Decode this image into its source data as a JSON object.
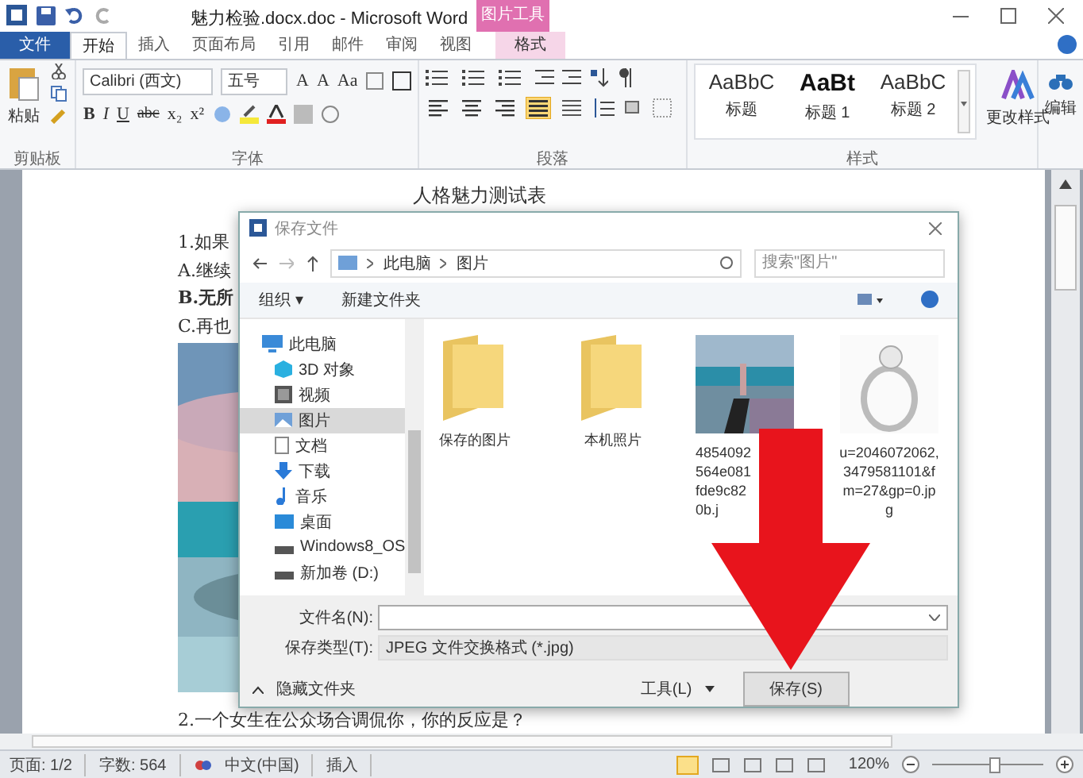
{
  "window": {
    "title": "魅力检验.docx.doc - Microsoft Word",
    "context_tab": "图片工具"
  },
  "tabs": [
    {
      "label": "文件",
      "kind": "file",
      "selected": false
    },
    {
      "label": "开始",
      "kind": "normal",
      "selected": true
    },
    {
      "label": "插入",
      "kind": "normal",
      "selected": false
    },
    {
      "label": "页面布局",
      "kind": "normal",
      "selected": false
    },
    {
      "label": "引用",
      "kind": "normal",
      "selected": false
    },
    {
      "label": "邮件",
      "kind": "normal",
      "selected": false
    },
    {
      "label": "审阅",
      "kind": "normal",
      "selected": false
    },
    {
      "label": "视图",
      "kind": "normal",
      "selected": false
    },
    {
      "label": "格式",
      "kind": "context",
      "selected": false
    }
  ],
  "ribbon": {
    "clipboard": {
      "paste": "粘贴",
      "label": "剪贴板"
    },
    "font": {
      "name": "Calibri (西文)",
      "size": "五号",
      "row1": [
        "A",
        "A",
        "Aa"
      ],
      "row2": [
        "B",
        "I",
        "U",
        "abc",
        "x₂",
        "x²"
      ],
      "label": "字体"
    },
    "paragraph": {
      "alignments": [
        {
          "kind": "left",
          "selected": false
        },
        {
          "kind": "center",
          "selected": false
        },
        {
          "kind": "right",
          "selected": false
        },
        {
          "kind": "justify",
          "selected": true
        },
        {
          "kind": "distributed",
          "selected": false
        }
      ],
      "label": "段落"
    },
    "styles": {
      "items": [
        {
          "preview": "AaBbC",
          "name": "标题",
          "kind": "normal"
        },
        {
          "preview": "AaBt",
          "name": "标题 1",
          "kind": "bold"
        },
        {
          "preview": "AaBbC",
          "name": "标题 2",
          "kind": "normal"
        }
      ],
      "change": "更改样式",
      "label": "样式"
    },
    "editing": {
      "label": "编辑"
    }
  },
  "document": {
    "title": "人格魅力测试表",
    "lines": [
      {
        "text": "1.如果",
        "bold": false
      },
      {
        "text": "A.继续",
        "bold": false
      },
      {
        "text": "B.无所",
        "bold": true
      },
      {
        "text": "C.再也",
        "bold": false
      }
    ],
    "after": "2.一个女生在公众场合调侃你，你的反应是？"
  },
  "dialog": {
    "title": "保存文件",
    "path": [
      "此电脑",
      "图片"
    ],
    "search": {
      "placeholder": "搜索\"图片\""
    },
    "organize": "组织 ▾",
    "new_folder": "新建文件夹",
    "nav": [
      {
        "label": "此电脑",
        "kind": "pc",
        "selected": false,
        "children": [
          {
            "label": "3D 对象",
            "kind": "cube",
            "selected": false
          },
          {
            "label": "视频",
            "kind": "video",
            "selected": false
          },
          {
            "label": "图片",
            "kind": "pictures",
            "selected": true
          },
          {
            "label": "文档",
            "kind": "doc",
            "selected": false
          },
          {
            "label": "下载",
            "kind": "download",
            "selected": false
          },
          {
            "label": "音乐",
            "kind": "music",
            "selected": false
          },
          {
            "label": "桌面",
            "kind": "desktop",
            "selected": false
          },
          {
            "label": "Windows8_OS",
            "kind": "drive",
            "selected": false
          },
          {
            "label": "新加卷 (D:)",
            "kind": "drive",
            "selected": false
          }
        ]
      }
    ],
    "files": [
      {
        "kind": "folder",
        "name_lines": [
          "保存的图片"
        ]
      },
      {
        "kind": "folder",
        "name_lines": [
          "本机照片"
        ]
      },
      {
        "name_lines": [
          "4854092",
          "564e081",
          "fde9c82",
          "0b.j"
        ]
      },
      {
        "kind": "ring",
        "name_lines": [
          "u=2046072062,",
          "3479581101&f",
          "m=27&gp=0.jp",
          "g"
        ]
      }
    ],
    "filename_label": "文件名(N):",
    "type_label": "保存类型(T):",
    "type_value": "JPEG 文件交换格式 (*.jpg)",
    "hide_folders": "隐藏文件夹",
    "tools": "工具(L)",
    "save": "保存(S)"
  },
  "status_bar": {
    "page": "页面: 1/2",
    "words": "字数: 564",
    "language": "中文(中国)",
    "mode": "插入",
    "zoom": "120%",
    "zoom_slider": {
      "level": 0.55
    }
  }
}
